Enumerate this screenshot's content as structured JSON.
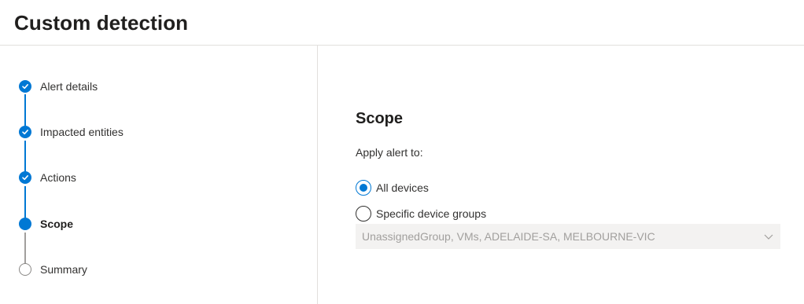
{
  "header": {
    "title": "Custom detection"
  },
  "wizard": {
    "steps": [
      {
        "label": "Alert details",
        "state": "completed"
      },
      {
        "label": "Impacted entities",
        "state": "completed"
      },
      {
        "label": "Actions",
        "state": "completed"
      },
      {
        "label": "Scope",
        "state": "current"
      },
      {
        "label": "Summary",
        "state": "not-started"
      }
    ]
  },
  "scope": {
    "title": "Scope",
    "apply_label": "Apply alert to:",
    "options": [
      {
        "label": "All devices",
        "selected": true
      },
      {
        "label": "Specific device groups",
        "selected": false
      }
    ],
    "device_groups_dropdown": {
      "value": "UnassignedGroup, VMs, ADELAIDE-SA, MELBOURNE-VIC",
      "disabled": true
    }
  },
  "colors": {
    "accent": "#0078d4",
    "line_inactive": "#a19f9d",
    "divider": "#e1dfdd",
    "dropdown_bg": "#f3f2f1"
  }
}
